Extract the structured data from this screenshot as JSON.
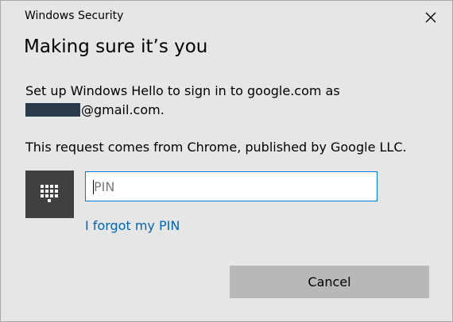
{
  "window": {
    "title": "Windows Security",
    "close_icon": "close-icon"
  },
  "dialog": {
    "heading": "Making sure it’s you",
    "line1": "Set up Windows Hello to sign in to google.com as",
    "email_suffix": "@gmail.com.",
    "line3": "This request comes from Chrome, published by Google LLC."
  },
  "pin": {
    "keypad_icon": "keypad-icon",
    "placeholder": "PIN",
    "value": "",
    "forgot_link": "I forgot my PIN"
  },
  "buttons": {
    "cancel": "Cancel"
  },
  "colors": {
    "background": "#e6e6e6",
    "accent": "#0078d7",
    "link": "#0066b4",
    "tile": "#404040",
    "button": "#b8b8b8"
  }
}
